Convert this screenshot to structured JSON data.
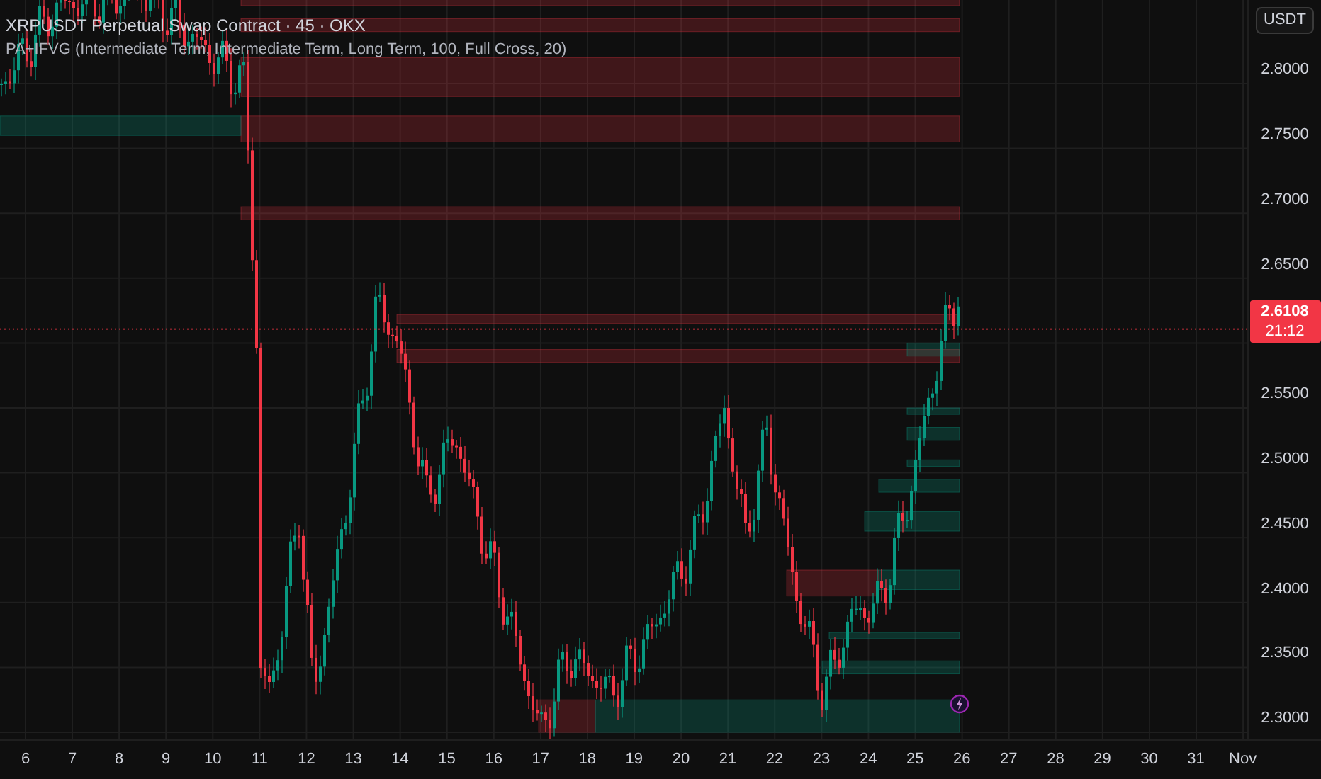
{
  "header": {
    "title": "XRPUSDT Perpetual Swap Contract · 45 · OKX",
    "indicator": "PA+IFVG (Intermediate Term, Intermediate Term, Long Term, 100, Full Cross, 20)"
  },
  "price_axis": {
    "currency_button": "USDT",
    "ticks_upper": [
      "2.8000",
      "2.7500",
      "2.7000",
      "2.6500"
    ],
    "ticks_lower": [
      "2.5500",
      "2.5000",
      "2.4500",
      "2.4000",
      "2.3500",
      "2.3000"
    ],
    "last_price": {
      "price": "2.6108",
      "countdown": "21:12"
    }
  },
  "time_axis": {
    "labels": [
      "6",
      "7",
      "8",
      "9",
      "10",
      "11",
      "12",
      "13",
      "14",
      "15",
      "16",
      "17",
      "18",
      "19",
      "20",
      "21",
      "22",
      "23",
      "24",
      "25",
      "26",
      "27",
      "28",
      "29",
      "30",
      "31",
      "Nov"
    ]
  }
}
